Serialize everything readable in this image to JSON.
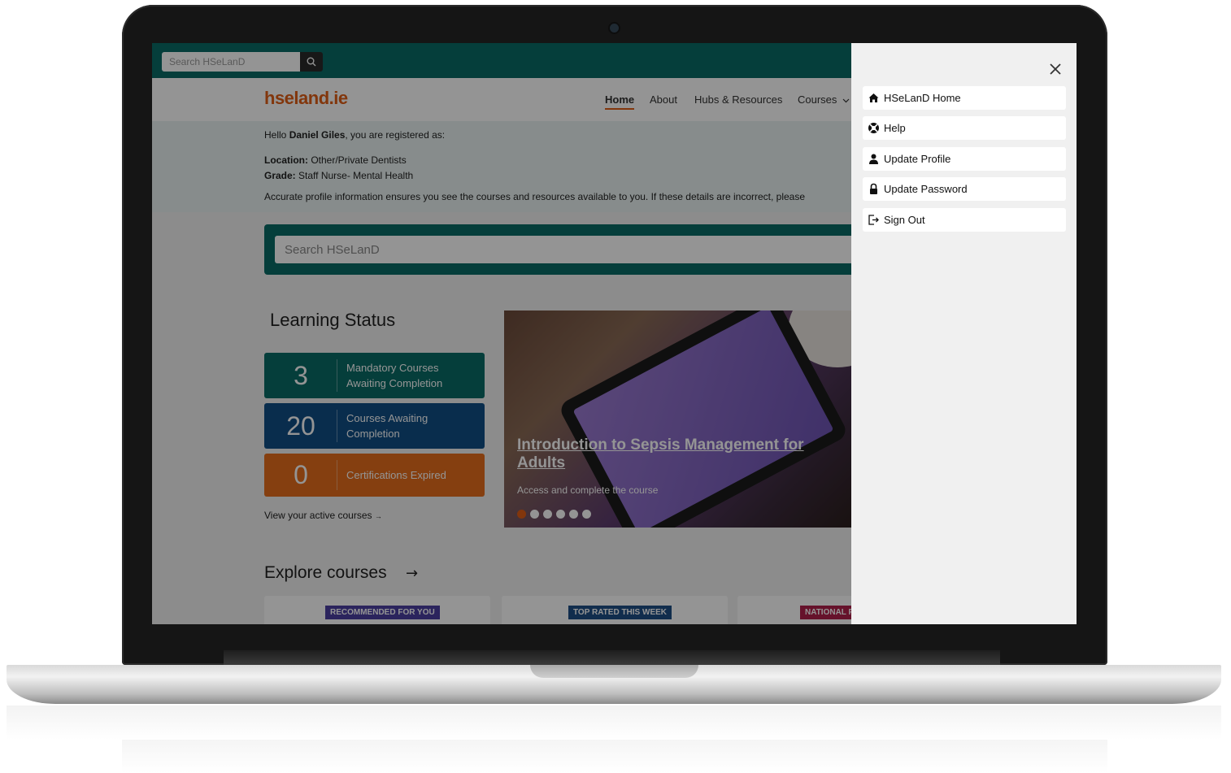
{
  "topbar": {
    "search_placeholder": "Search HSeLanD"
  },
  "navbar": {
    "logo": "hseland.ie",
    "items": [
      {
        "label": "Home",
        "active": true
      },
      {
        "label": "About"
      },
      {
        "label": "Hubs & Resources"
      },
      {
        "label": "Courses"
      }
    ]
  },
  "welcome": {
    "greeting_prefix": "Hello ",
    "user_name": "Daniel Giles",
    "greeting_suffix": ", you are registered as:",
    "location_label": "Location:",
    "location_value": " Other/Private Dentists",
    "grade_label": "Grade:",
    "grade_value": " Staff Nurse- Mental Health",
    "notice": "Accurate profile information ensures you see the courses and resources available to you. If these details are incorrect, please"
  },
  "hero_search": {
    "placeholder": "Search HSeLanD"
  },
  "learning_status": {
    "title": "Learning Status",
    "stats": [
      {
        "count": "3",
        "label_line1": "Mandatory Courses",
        "label_line2": "Awaiting Completion",
        "color": "#0a6b66"
      },
      {
        "count": "20",
        "label_line1": "Courses Awaiting",
        "label_line2": "Completion",
        "color": "#114f86"
      },
      {
        "count": "0",
        "label_line1": "Certifications Expired",
        "label_line2": "",
        "color": "#e56d1c"
      }
    ],
    "view_active": "View your active courses"
  },
  "carousel": {
    "title_line1": "Introduction to Sepsis Management for",
    "title_line2": "Adults",
    "subtitle": "Access and complete the course",
    "slide_count": 6,
    "active_slide": 1
  },
  "explore": {
    "title": "Explore courses",
    "tags": [
      {
        "label": "RECOMMENDED FOR YOU",
        "color": "#4a3ea0"
      },
      {
        "label": "TOP RATED THIS WEEK",
        "color": "#1e4f86"
      },
      {
        "label": "NATIONAL F",
        "color": "#b0204a"
      }
    ]
  },
  "side_menu": {
    "items": [
      {
        "label": "HSeLanD Home",
        "icon": "home-icon"
      },
      {
        "label": "Help",
        "icon": "lifebuoy-icon"
      },
      {
        "label": "Update Profile",
        "icon": "user-icon"
      },
      {
        "label": "Update Password",
        "icon": "lock-icon"
      },
      {
        "label": "Sign Out",
        "icon": "sign-out-icon"
      }
    ]
  },
  "colors": {
    "brand_orange": "#e05e16",
    "teal": "#0a6b66"
  }
}
